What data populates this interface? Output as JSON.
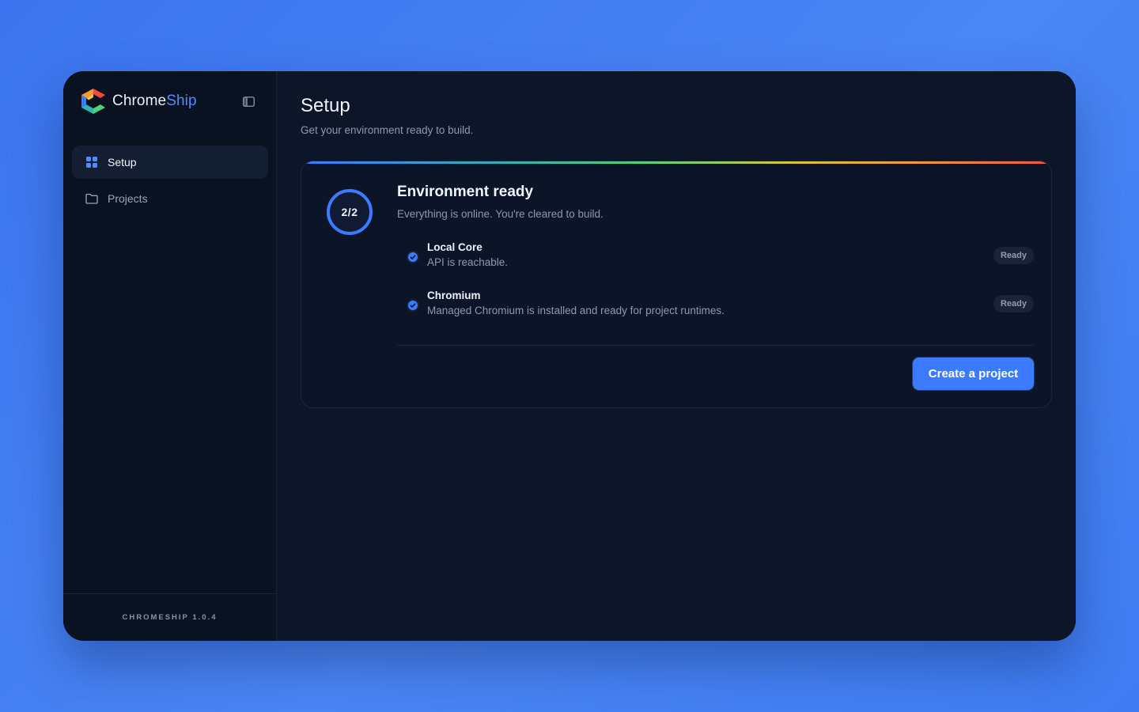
{
  "brand": {
    "name_part1": "Chrome",
    "name_part2": "Ship",
    "accent_color": "#4f8cff"
  },
  "sidebar": {
    "collapse_icon": "sidebar-toggle-icon",
    "items": [
      {
        "label": "Setup",
        "icon": "grid-icon",
        "active": true
      },
      {
        "label": "Projects",
        "icon": "folder-icon",
        "active": false
      }
    ],
    "version": "CHROMESHIP 1.0.4"
  },
  "main": {
    "title": "Setup",
    "subtitle": "Get your environment ready to build."
  },
  "status_card": {
    "progress": {
      "label": "2/2",
      "completed": 2,
      "total": 2
    },
    "title": "Environment ready",
    "description": "Everything is online. You're cleared to build.",
    "checks": [
      {
        "name": "Local Core",
        "description": "API is reachable.",
        "status": "Ready"
      },
      {
        "name": "Chromium",
        "description": "Managed Chromium is installed and ready for project runtimes.",
        "status": "Ready"
      }
    ],
    "action_label": "Create a project"
  },
  "colors": {
    "background": "#3f7cf2",
    "window": "#0d1629",
    "sidebar": "#0a1222",
    "primary": "#3c7bff"
  }
}
